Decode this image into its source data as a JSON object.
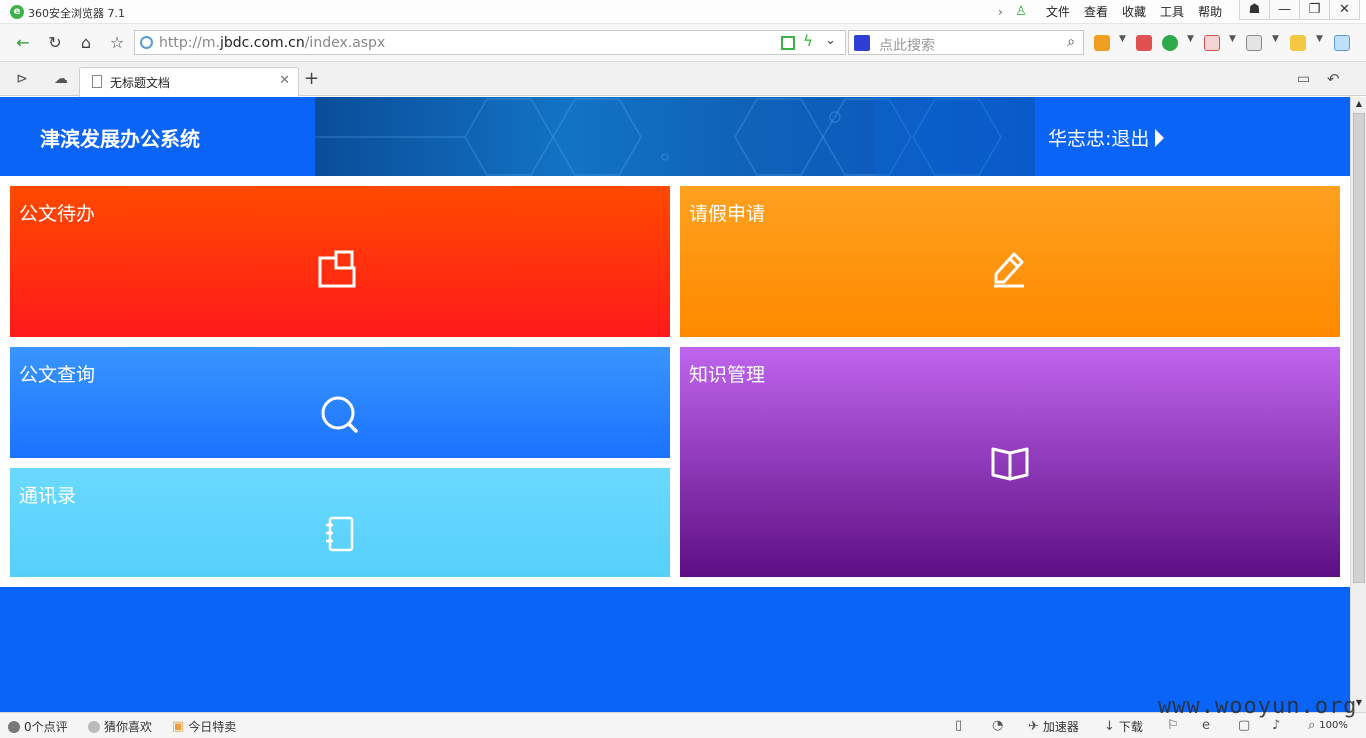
{
  "browser": {
    "app_title": "360安全浏览器 7.1",
    "menu": [
      "文件",
      "查看",
      "收藏",
      "工具",
      "帮助"
    ],
    "address": {
      "scheme": "http://m.",
      "domain": "jbdc.com.cn",
      "path": "/index.aspx"
    },
    "search_placeholder": "点此搜索",
    "tab_title": "无标题文档",
    "status": {
      "comments": "0个点评",
      "guess": "猜你喜欢",
      "deals": "今日特卖",
      "accelerator": "加速器",
      "download": "下载",
      "zoom": "100%"
    },
    "watermark": "www.wooyun.org"
  },
  "page": {
    "system_title": "津滨发展办公系统",
    "user_logout": "华志忠:退出",
    "tiles": [
      {
        "label": "公文待办",
        "icon": "folder-icon",
        "color": "#ff2b10"
      },
      {
        "label": "请假申请",
        "icon": "pencil-icon",
        "color": "#ff9310"
      },
      {
        "label": "公文查询",
        "icon": "search-icon",
        "color": "#2a84ff"
      },
      {
        "label": "知识管理",
        "icon": "book-icon",
        "color": "#8f3abb"
      },
      {
        "label": "通讯录",
        "icon": "notebook-icon",
        "color": "#5fd5fd"
      }
    ],
    "accent_color": "#0a64f8"
  }
}
